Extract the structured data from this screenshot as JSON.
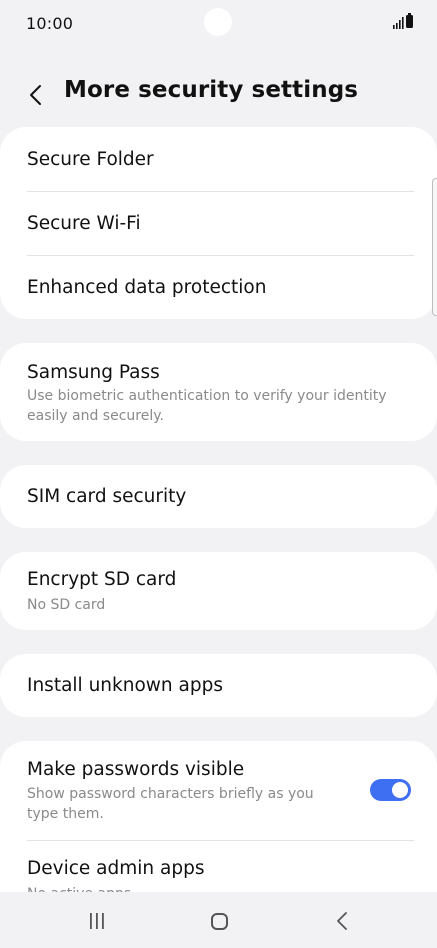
{
  "status_bar": {
    "time": "10:00"
  },
  "header": {
    "title": "More security settings"
  },
  "items": {
    "secure_folder": {
      "title": "Secure Folder"
    },
    "secure_wifi": {
      "title": "Secure Wi-Fi"
    },
    "enhanced_data": {
      "title": "Enhanced data protection"
    },
    "samsung_pass": {
      "title": "Samsung Pass",
      "subtitle": "Use biometric authentication to verify your identity easily and securely."
    },
    "sim_security": {
      "title": "SIM card security"
    },
    "encrypt_sd": {
      "title": "Encrypt SD card",
      "subtitle": "No SD card"
    },
    "install_unknown": {
      "title": "Install unknown apps"
    },
    "make_passwords": {
      "title": "Make passwords visible",
      "subtitle": "Show password characters briefly as you type them.",
      "toggle_on": true
    },
    "device_admin": {
      "title": "Device admin apps",
      "subtitle": "No active apps"
    }
  },
  "colors": {
    "accent": "#3e6ff2",
    "background": "#f2f2f4",
    "card": "#ffffff"
  },
  "icons": {
    "back": "chevron-left-icon",
    "signal": "signal-icon",
    "battery": "battery-icon",
    "recents": "recent-apps-icon",
    "home": "home-icon",
    "nav_back": "nav-back-icon"
  }
}
